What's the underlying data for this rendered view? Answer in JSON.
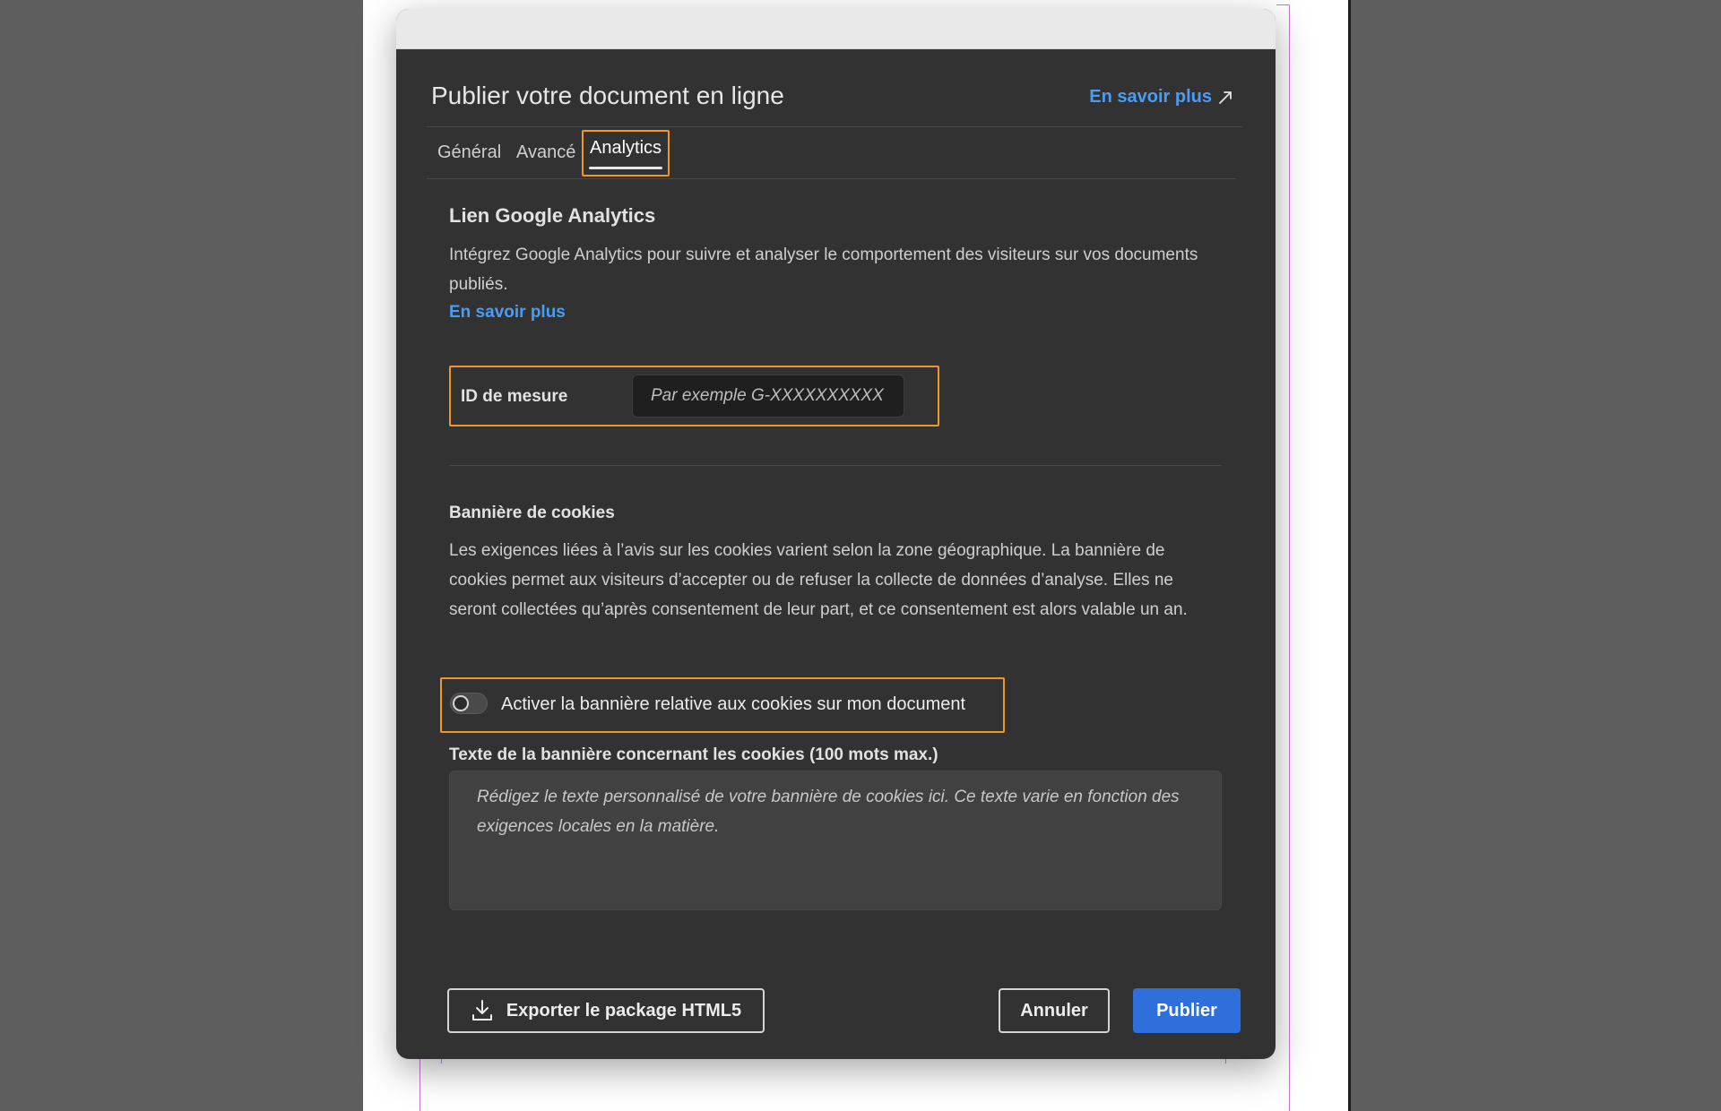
{
  "dialog": {
    "title": "Publier votre document en ligne",
    "learn_more_label": "En savoir plus"
  },
  "tabs": [
    {
      "label": "Général",
      "active": false
    },
    {
      "label": "Avancé",
      "active": false
    },
    {
      "label": "Analytics",
      "active": true
    }
  ],
  "analytics": {
    "heading": "Lien Google Analytics",
    "description": "Intégrez Google Analytics pour suivre et analyser le comportement des visiteurs sur vos documents publiés.",
    "learn_more_label": "En savoir plus",
    "measure_id": {
      "label": "ID de mesure",
      "value": "",
      "placeholder": "Par exemple G-XXXXXXXXXX"
    }
  },
  "cookies": {
    "heading": "Bannière de cookies",
    "description": "Les exigences liées à l’avis sur les cookies varient selon la zone géographique. La bannière de cookies permet aux visiteurs d’accepter ou de refuser la collecte de données d’analyse. Elles ne seront collectées qu’après consentement de leur part, et ce consentement est alors valable un an.",
    "toggle_label": "Activer la bannière relative aux cookies sur mon document",
    "toggle_on": false,
    "banner_text_label": "Texte de la bannière concernant les cookies (100 mots max.)",
    "banner_text_value": "",
    "banner_text_placeholder": "Rédigez le texte personnalisé de votre bannière de cookies ici. Ce texte varie en fonction des exigences locales en la matière."
  },
  "footer": {
    "export_label": "Exporter le package HTML5",
    "cancel_label": "Annuler",
    "publish_label": "Publier"
  },
  "icons": {
    "external": "external-link-icon",
    "download": "download-icon"
  },
  "colors": {
    "accent_link": "#4b9cf5",
    "highlight": "#f0962a",
    "primary_button": "#2f6fdc",
    "dialog_bg": "#323232"
  }
}
